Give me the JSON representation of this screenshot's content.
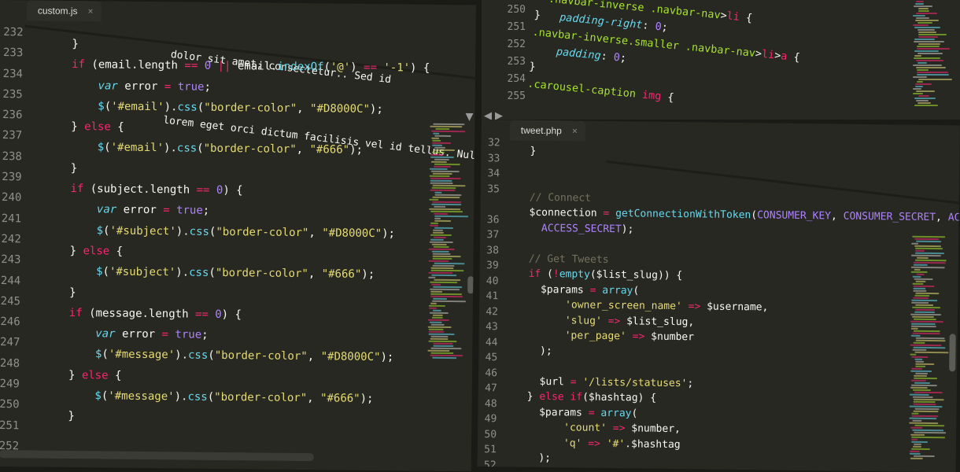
{
  "colors": {
    "background": "#272822",
    "keyword": "#f92672",
    "string": "#e6db74",
    "number": "#ae81ff",
    "function": "#66d9ef",
    "comment": "#75715e",
    "selector": "#a6e22e"
  },
  "left_pane": {
    "tab_title": "custom.js",
    "top_text_1": "dolor sit amet, consectetur.. Sed id",
    "top_text_2": "lorem eget orci dictum facilisis vel id tellus. Nullam",
    "line_numbers": [
      "232",
      "233",
      "234",
      "235",
      "236",
      "237",
      "238",
      "239",
      "240",
      "241",
      "242",
      "243",
      "244",
      "245",
      "246",
      "247",
      "248",
      "249",
      "250",
      "251",
      "252"
    ]
  },
  "top_right_pane": {
    "line_numbers": [
      "250",
      "251",
      "252",
      "253",
      "254",
      "255"
    ]
  },
  "right_pane": {
    "tab_title": "tweet.php",
    "line_numbers": [
      "32",
      "33",
      "34",
      "35",
      "",
      "36",
      "37",
      "38",
      "39",
      "40",
      "41",
      "42",
      "43",
      "44",
      "45",
      "46",
      "47",
      "48",
      "49",
      "50",
      "51",
      "52"
    ]
  },
  "icons": {
    "tab_close": "×",
    "dropdown": "▼",
    "nav_left": "◀",
    "nav_right": "▶"
  }
}
